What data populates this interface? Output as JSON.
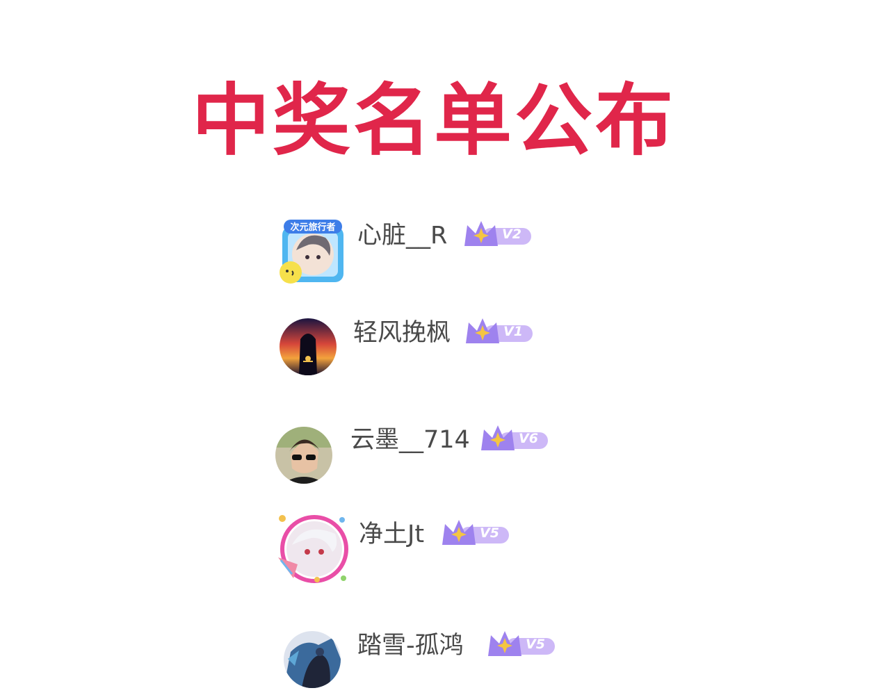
{
  "title": "中奖名单公布",
  "colors": {
    "title": "#e0264a",
    "name": "#4a4a4a",
    "badge_light": "#cdb8f7",
    "badge_dark": "#8f6ee8",
    "badge_star": "#f5c542"
  },
  "winners": [
    {
      "name": "心脏__R",
      "level": "V2",
      "avatar_icon": "anime-boy-avatar-with-frame-icon"
    },
    {
      "name": "轻风挽枫",
      "level": "V1",
      "avatar_icon": "sunset-silhouette-avatar-icon"
    },
    {
      "name": "云墨__714",
      "level": "V6",
      "avatar_icon": "person-sunglasses-avatar-icon"
    },
    {
      "name": "净土Jt",
      "level": "V5",
      "avatar_icon": "anime-white-hair-avatar-with-frame-icon"
    },
    {
      "name": "踏雪-孤鸿",
      "level": "V5",
      "avatar_icon": "blue-eagle-warrior-avatar-icon"
    }
  ]
}
